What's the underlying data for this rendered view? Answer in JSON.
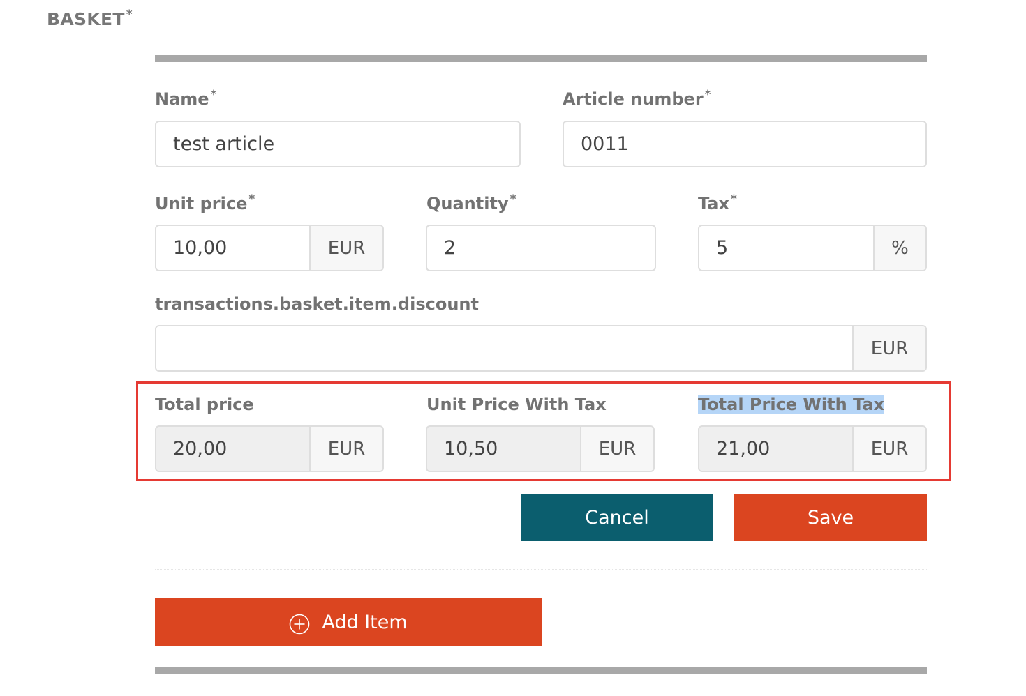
{
  "section": {
    "title": "BASKET",
    "required_mark": "*"
  },
  "form": {
    "name": {
      "label": "Name",
      "required_mark": "*",
      "value": "test article"
    },
    "article_number": {
      "label": "Article number",
      "required_mark": "*",
      "value": "0011"
    },
    "unit_price": {
      "label": "Unit price",
      "required_mark": "*",
      "value": "10,00",
      "unit": "EUR"
    },
    "quantity": {
      "label": "Quantity",
      "required_mark": "*",
      "value": "2"
    },
    "tax": {
      "label": "Tax",
      "required_mark": "*",
      "value": "5",
      "unit": "%"
    },
    "discount": {
      "label": "transactions.basket.item.discount",
      "value": "",
      "unit": "EUR"
    },
    "total_price": {
      "label": "Total price",
      "value": "20,00",
      "unit": "EUR"
    },
    "unit_price_with_tax": {
      "label": "Unit Price With Tax",
      "value": "10,50",
      "unit": "EUR"
    },
    "total_price_with_tax": {
      "label": "Total Price With Tax",
      "value": "21,00",
      "unit": "EUR"
    }
  },
  "actions": {
    "cancel_label": "Cancel",
    "save_label": "Save",
    "add_item_label": "Add Item"
  },
  "icons": {
    "add_item": "circle-plus-icon"
  },
  "colors": {
    "cancel_button": "#0b5e6e",
    "save_button": "#db4520",
    "add_item_button": "#db4520",
    "highlight_border": "#e53a33",
    "text_selection": "#b5d5f7"
  }
}
